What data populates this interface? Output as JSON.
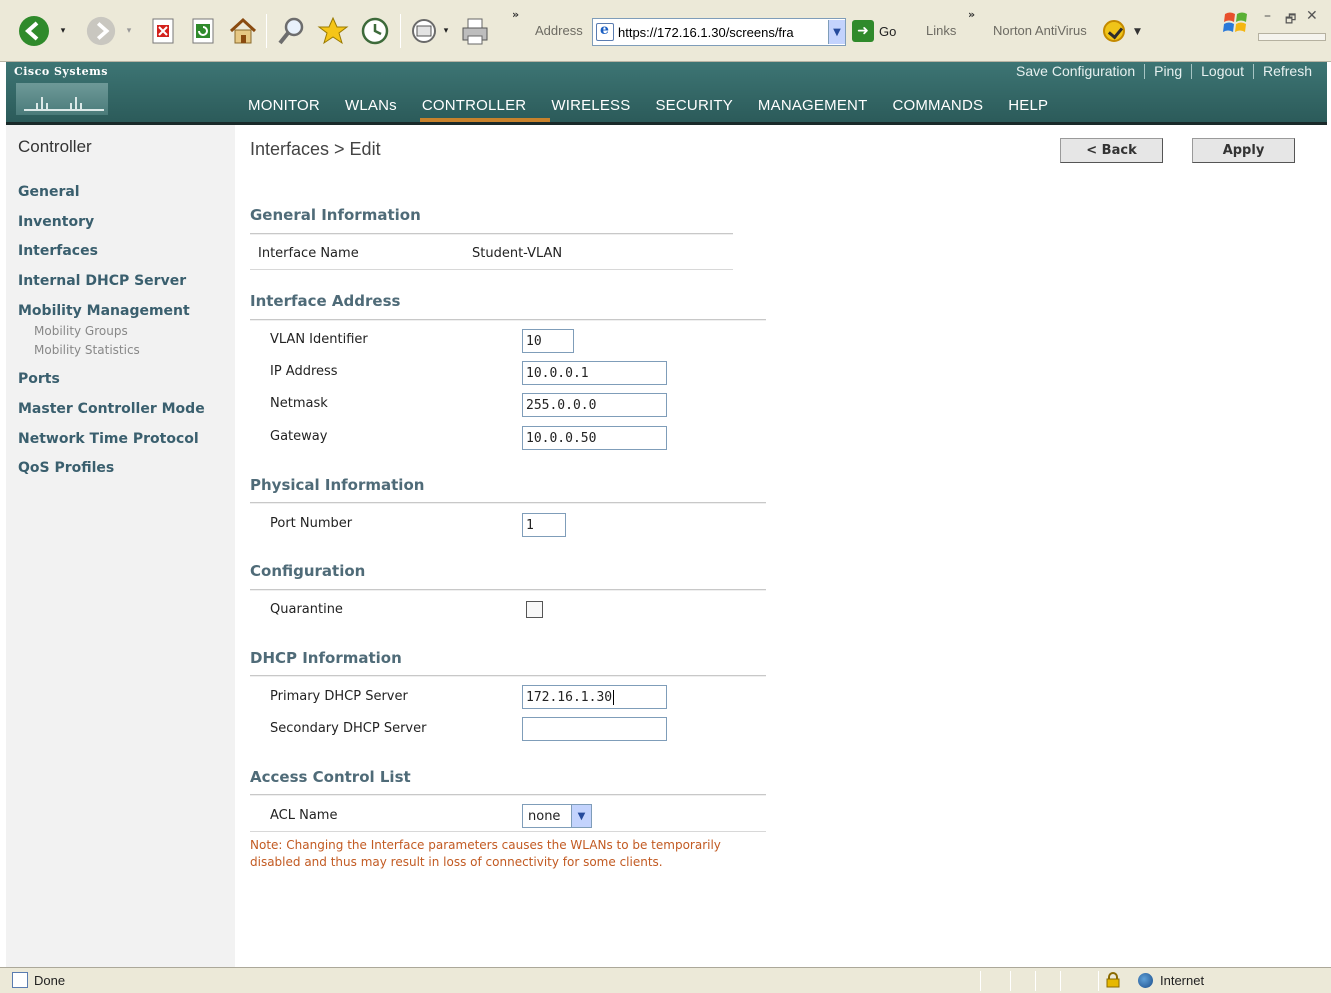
{
  "browser": {
    "more_chevron": "»",
    "address_label": "Address",
    "address_url": "https://172.16.1.30/screens/fra",
    "go_label": "Go",
    "links_label": "Links",
    "links_chevron": "»",
    "norton_label": "Norton AntiVirus",
    "window_controls": {
      "minimize": "–",
      "restore": "🗗",
      "close": "✕"
    },
    "status_text": "Done",
    "zone_text": "Internet"
  },
  "header": {
    "brand": "Cisco Systems",
    "top_links": [
      "Save Configuration",
      "Ping",
      "Logout",
      "Refresh"
    ],
    "nav": [
      "MONITOR",
      "WLANs",
      "CONTROLLER",
      "WIRELESS",
      "SECURITY",
      "MANAGEMENT",
      "COMMANDS",
      "HELP"
    ],
    "active_nav": "CONTROLLER",
    "accent_color": "#c8822c",
    "header_color": "#3d7574"
  },
  "sidebar": {
    "title": "Controller",
    "items": [
      {
        "label": "General"
      },
      {
        "label": "Inventory"
      },
      {
        "label": "Interfaces"
      },
      {
        "label": "Internal DHCP Server"
      },
      {
        "label": "Mobility Management"
      },
      {
        "label": "Mobility Groups"
      },
      {
        "label": "Mobility Statistics"
      },
      {
        "label": "Ports"
      },
      {
        "label": "Master Controller Mode"
      },
      {
        "label": "Network Time Protocol"
      },
      {
        "label": "QoS Profiles"
      }
    ]
  },
  "page": {
    "title": "Interfaces > Edit",
    "back_label": "< Back",
    "apply_label": "Apply",
    "sections": {
      "general": "General Information",
      "address": "Interface Address",
      "physical": "Physical Information",
      "configuration": "Configuration",
      "dhcp": "DHCP Information",
      "acl": "Access Control List"
    },
    "fields": {
      "interface_name_label": "Interface Name",
      "interface_name_value": "Student-VLAN",
      "vlan_label": "VLAN Identifier",
      "vlan_value": "10",
      "ip_label": "IP Address",
      "ip_value": "10.0.0.1",
      "netmask_label": "Netmask",
      "netmask_value": "255.0.0.0",
      "gateway_label": "Gateway",
      "gateway_value": "10.0.0.50",
      "port_label": "Port Number",
      "port_value": "1",
      "quarantine_label": "Quarantine",
      "quarantine_checked": false,
      "primary_dhcp_label": "Primary DHCP Server",
      "primary_dhcp_value": "172.16.1.30",
      "secondary_dhcp_label": "Secondary DHCP Server",
      "secondary_dhcp_value": "",
      "acl_label": "ACL Name",
      "acl_value": "none"
    },
    "note": "Note: Changing the Interface parameters causes the WLANs to be temporarily disabled and thus may result in loss of connectivity for some clients.",
    "note_color": "#c25a22"
  }
}
